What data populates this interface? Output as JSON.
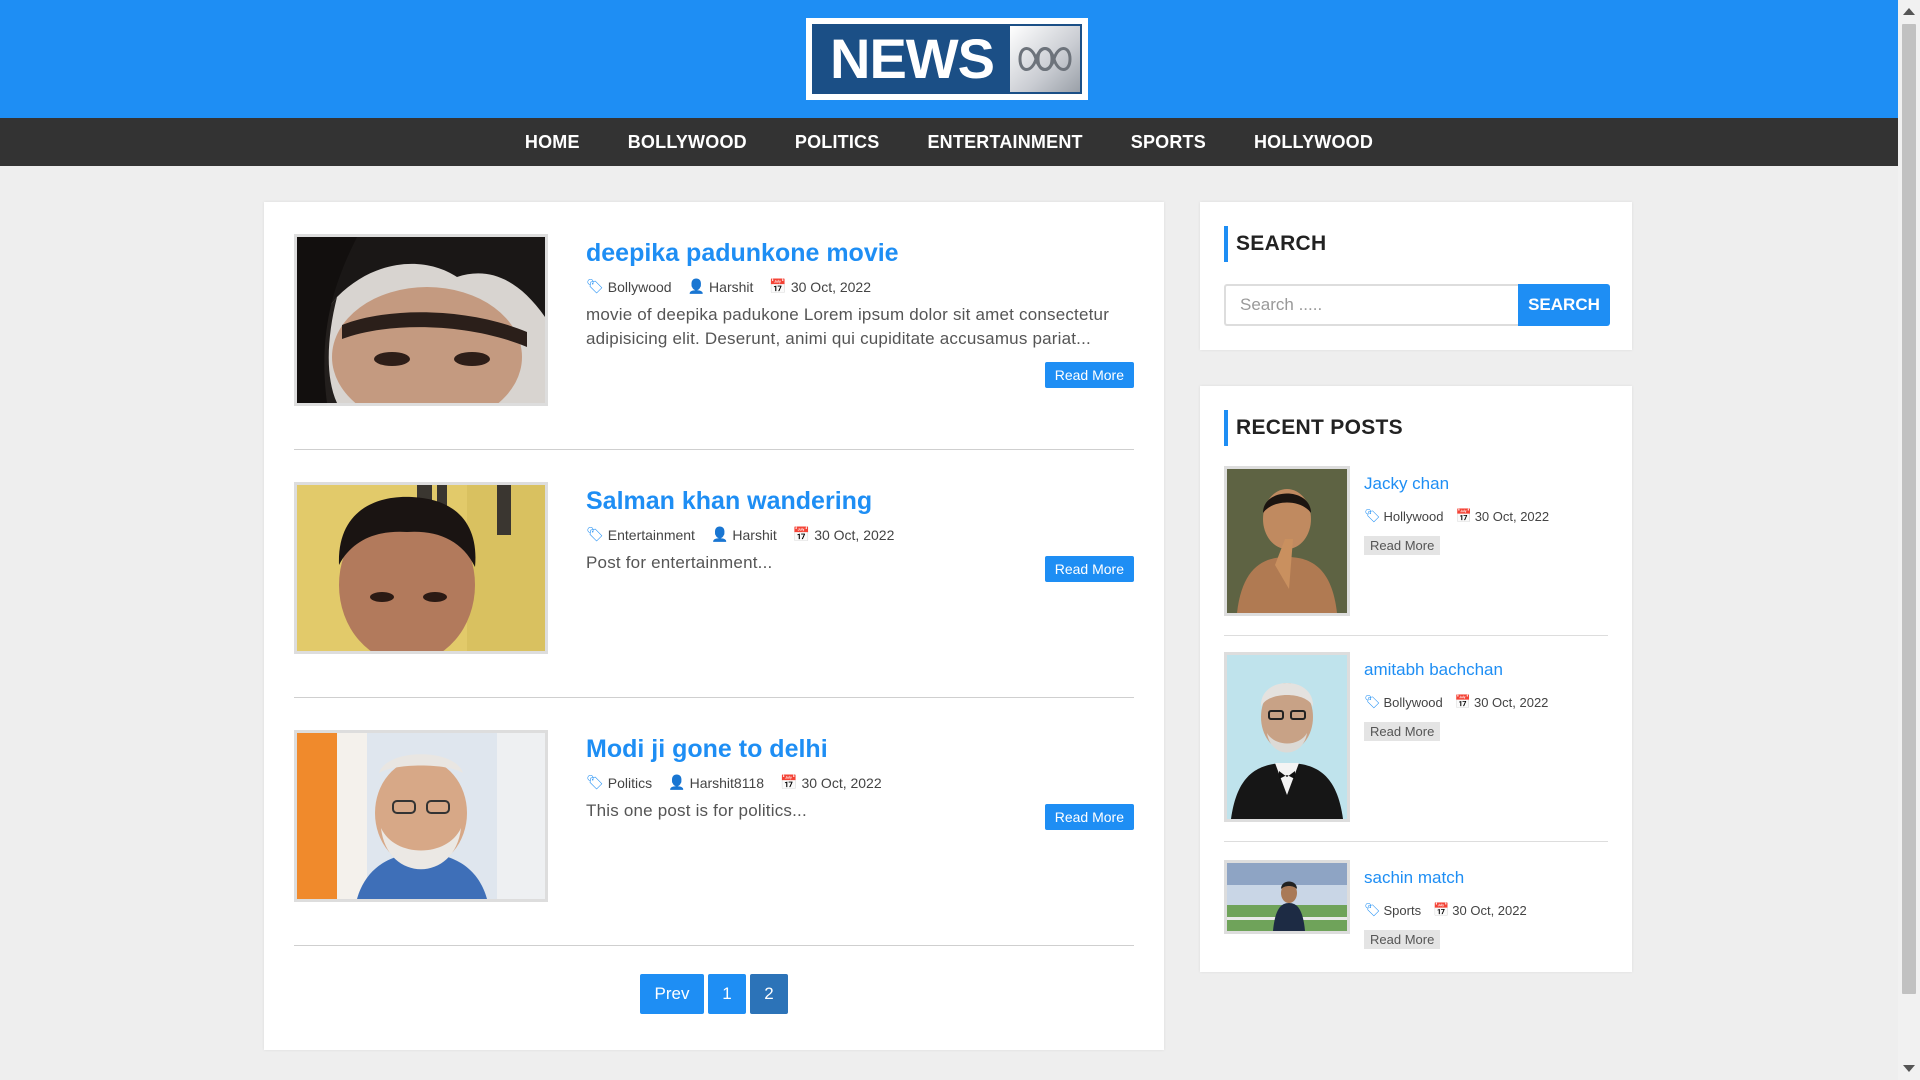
{
  "brand": {
    "logo_text": "NEWS"
  },
  "nav": {
    "items": [
      {
        "label": "HOME"
      },
      {
        "label": "BOLLYWOOD"
      },
      {
        "label": "POLITICS"
      },
      {
        "label": "ENTERTAINMENT"
      },
      {
        "label": "SPORTS"
      },
      {
        "label": "HOLLYWOOD"
      }
    ]
  },
  "posts": [
    {
      "title": "deepika padunkone movie",
      "category": "Bollywood",
      "author": "Harshit",
      "date": "30 Oct, 2022",
      "excerpt": "movie of deepika padukone Lorem ipsum dolor sit amet consectetur adipisicing elit. Deserunt, animi qui cupiditate accusamus pariat...",
      "read_more": "Read More"
    },
    {
      "title": "Salman khan wandering",
      "category": "Entertainment",
      "author": "Harshit",
      "date": "30 Oct, 2022",
      "excerpt": "Post for entertainment...",
      "read_more": "Read More"
    },
    {
      "title": "Modi ji gone to delhi",
      "category": "Politics",
      "author": "Harshit8118",
      "date": "30 Oct, 2022",
      "excerpt": "This one post is for politics...",
      "read_more": "Read More"
    }
  ],
  "pagination": {
    "prev": "Prev",
    "page1": "1",
    "page2": "2",
    "current": "2"
  },
  "search": {
    "title": "SEARCH",
    "placeholder": "Search .....",
    "button": "SEARCH"
  },
  "recent": {
    "title": "RECENT POSTS",
    "items": [
      {
        "title": "Jacky chan",
        "category": "Hollywood",
        "date": "30 Oct, 2022",
        "read_more": "Read More"
      },
      {
        "title": "amitabh bachchan",
        "category": "Bollywood",
        "date": "30 Oct, 2022",
        "read_more": "Read More"
      },
      {
        "title": "sachin match",
        "category": "Sports",
        "date": "30 Oct, 2022",
        "read_more": "Read More"
      }
    ]
  },
  "icons": {
    "tag": "tag-icon",
    "user": "user-icon",
    "calendar": "calendar-icon"
  },
  "colors": {
    "accent": "#1e8ef4",
    "nav_bg": "#333333",
    "page_bg": "#eeeeee",
    "pager_active": "#2c73b8"
  }
}
